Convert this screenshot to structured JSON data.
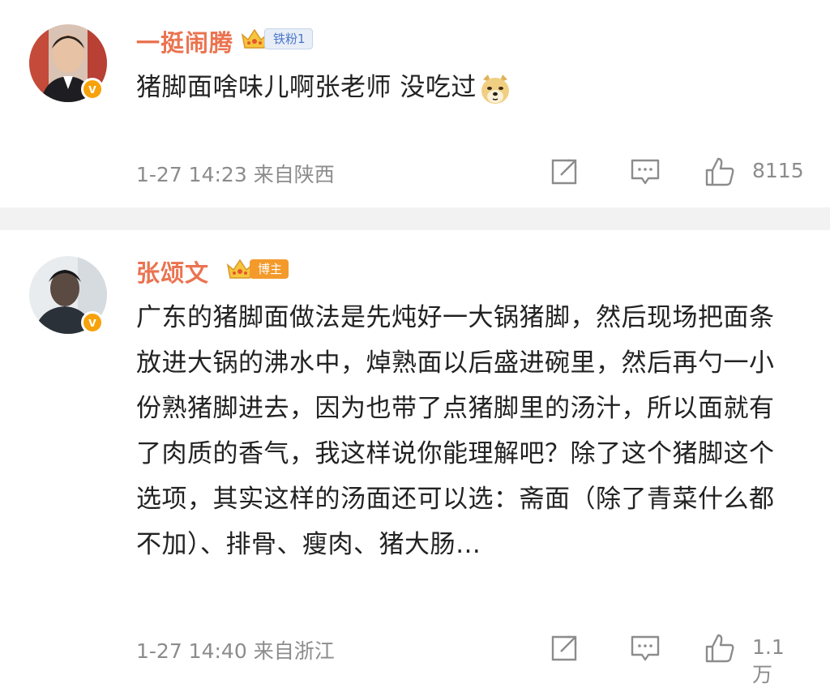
{
  "comments": [
    {
      "username": "一挺闹腾",
      "badge": "铁粉1",
      "verified_mark": "v",
      "text": "猪脚面啥味儿啊张老师 没吃过",
      "emoji": "doge-emoji",
      "time": "1-27 14:23",
      "location": "来自陕西",
      "likes": "8115"
    },
    {
      "username": "张颂文",
      "badge": "博主",
      "verified_mark": "v",
      "text": "广东的猪脚面做法是先炖好一大锅猪脚，然后现场把面条放进大锅的沸水中，焯熟面以后盛进碗里，然后再勺一小份熟猪脚进去，因为也带了点猪脚里的汤汁，所以面就有了肉质的香气，我这样说你能理解吧？除了这个猪脚这个选项，其实这样的汤面还可以选：斋面（除了青菜什么都不加）、排骨、瘦肉、猪大肠…",
      "time": "1-27 14:40",
      "location": "来自浙江",
      "likes": "1.1万"
    }
  ],
  "colors": {
    "username": "#eb7350",
    "meta": "#8c8c8c",
    "divider": "#f2f2f2",
    "verified": "#f7a20a"
  },
  "icons": [
    "share-icon",
    "comment-icon",
    "like-icon",
    "crown-icon"
  ]
}
